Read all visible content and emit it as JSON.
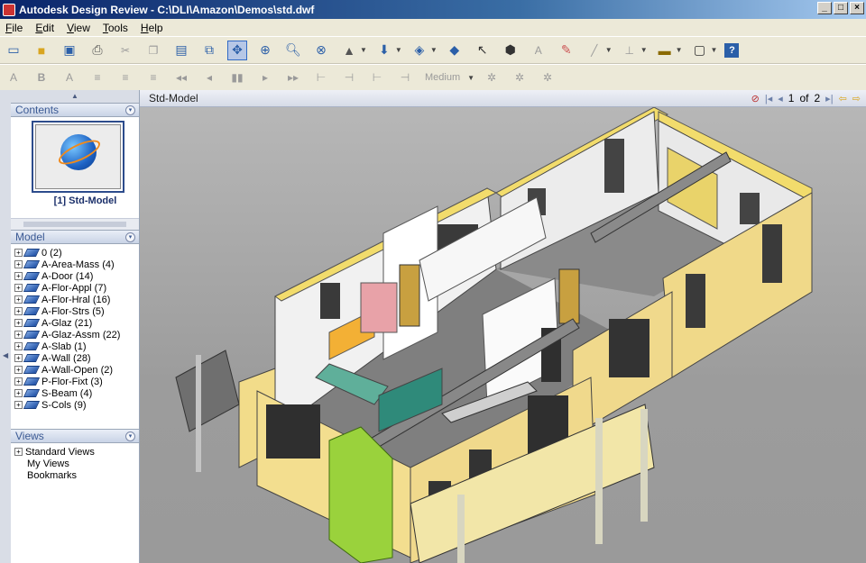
{
  "window": {
    "title": "Autodesk Design Review - C:\\DLI\\Amazon\\Demos\\std.dwf",
    "btn_min": "_",
    "btn_max": "□",
    "btn_close": "×"
  },
  "menu": [
    "File",
    "Edit",
    "View",
    "Tools",
    "Help"
  ],
  "toolbar2": {
    "speed_label": "Medium"
  },
  "left": {
    "contents_header": "Contents",
    "thumbnail_label": "[1] Std-Model",
    "model_header": "Model",
    "model_items": [
      "0 (2)",
      "A-Area-Mass (4)",
      "A-Door (14)",
      "A-Flor-Appl (7)",
      "A-Flor-Hral (16)",
      "A-Flor-Strs (5)",
      "A-Glaz (21)",
      "A-Glaz-Assm (22)",
      "A-Slab (1)",
      "A-Wall (28)",
      "A-Wall-Open (2)",
      "P-Flor-Fixt (3)",
      "S-Beam (4)",
      "S-Cols (9)"
    ],
    "views_header": "Views",
    "views_items": [
      "Standard Views",
      "My Views",
      "Bookmarks"
    ]
  },
  "viewer": {
    "tab_title": "Std-Model",
    "page_current": "1",
    "page_of": "of",
    "page_total": "2"
  },
  "colors": {
    "accent": "#316ac5",
    "panel_head_text": "#3b5a94",
    "viewport_bg": "#a8a8a8"
  }
}
